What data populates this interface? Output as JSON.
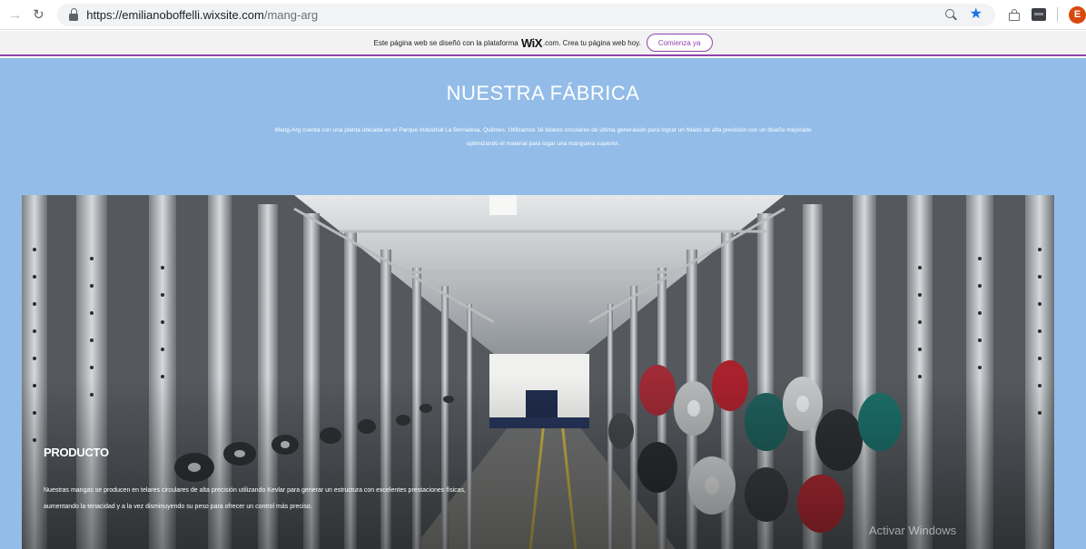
{
  "browser": {
    "url_host": "https://emilianoboffelli.wixsite.com",
    "url_path": "/mang-arg",
    "avatar_letter": "E",
    "accent_color": "#1a73e8"
  },
  "wix_banner": {
    "text_before": "Este página web se diseñó con la plataforma",
    "logo": "WiX",
    "text_after": ".com. Crea tu página web hoy.",
    "button_label": "Comienza ya"
  },
  "hero": {
    "title": "NUESTRA FÁBRICA",
    "intro": "Mang-Arg cuenta con una planta ubicada en el Parque Industrial La Bernalesa, Quilmes. Utilizamos 16 telares circulares de ultima generación para lograr un hilado de alta precisión con un diseño mejorado optimizando el material para logar una manguera superior."
  },
  "product": {
    "title": "PRODUCTO",
    "text": "Nuestras mangas se producen en telares circulares de alta precisión utilizando Kevlar para generar un estructura con excelentes prestaciones físicas, aumentando la tenacidad y a la vez disminuyendo su peso para ofrecer un control más preciso."
  },
  "watermark": "Activar Windows",
  "colors": {
    "page_background": "#93bde8",
    "wix_accent": "#8e44ad"
  }
}
